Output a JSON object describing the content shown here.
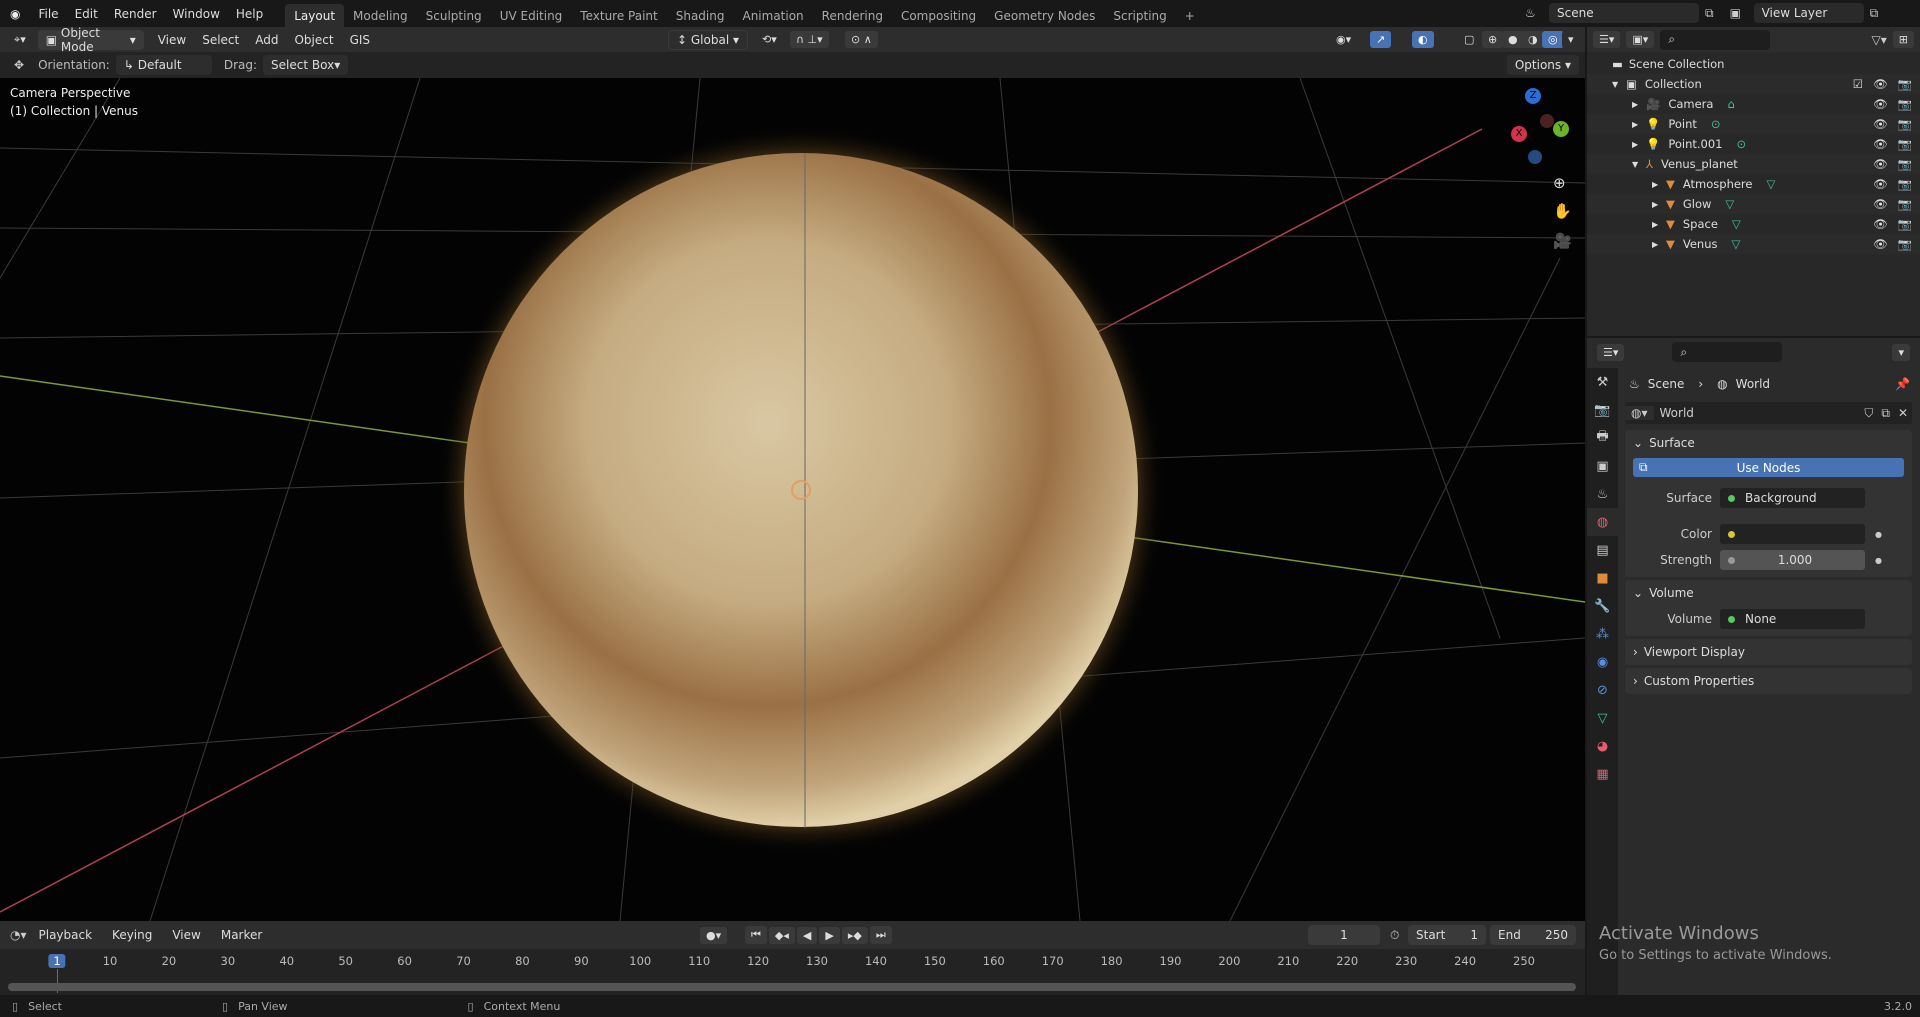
{
  "topbar": {
    "menus": [
      "File",
      "Edit",
      "Render",
      "Window",
      "Help"
    ],
    "workspaces": [
      "Layout",
      "Modeling",
      "Sculpting",
      "UV Editing",
      "Texture Paint",
      "Shading",
      "Animation",
      "Rendering",
      "Compositing",
      "Geometry Nodes",
      "Scripting"
    ],
    "active_workspace": "Layout",
    "add": "+",
    "scene": "Scene",
    "view_layer": "View Layer"
  },
  "viewport_header": {
    "mode": "Object Mode",
    "menus": [
      "View",
      "Select",
      "Add",
      "Object",
      "GIS"
    ],
    "transform": "Global"
  },
  "tool_settings": {
    "orientation_label": "Orientation:",
    "orientation": "Default",
    "drag_label": "Drag:",
    "drag": "Select Box",
    "options": "Options"
  },
  "viewport": {
    "camera": "Camera Perspective",
    "collection": "(1) Collection | Venus",
    "gizmo": {
      "x": "X",
      "y": "Y",
      "z": "Z"
    }
  },
  "outliner": {
    "root": "Scene Collection",
    "items": [
      {
        "name": "Collection",
        "depth": 0,
        "icon": "collection"
      },
      {
        "name": "Camera",
        "depth": 1,
        "icon": "camera"
      },
      {
        "name": "Point",
        "depth": 1,
        "icon": "light"
      },
      {
        "name": "Point.001",
        "depth": 1,
        "icon": "light"
      },
      {
        "name": "Venus_planet",
        "depth": 1,
        "icon": "empty"
      },
      {
        "name": "Atmosphere",
        "depth": 2,
        "icon": "mesh"
      },
      {
        "name": "Glow",
        "depth": 2,
        "icon": "mesh"
      },
      {
        "name": "Space",
        "depth": 2,
        "icon": "mesh"
      },
      {
        "name": "Venus",
        "depth": 2,
        "icon": "mesh"
      }
    ]
  },
  "properties": {
    "breadcrumb": [
      "Scene",
      "World"
    ],
    "datablock": "World",
    "surface": {
      "title": "Surface",
      "use_nodes": "Use Nodes",
      "surface_label": "Surface",
      "surface_value": "Background",
      "color_label": "Color",
      "strength_label": "Strength",
      "strength": "1.000"
    },
    "volume": {
      "title": "Volume",
      "label": "Volume",
      "value": "None"
    },
    "viewport_display": "Viewport Display",
    "custom_properties": "Custom Properties"
  },
  "timeline": {
    "menus": [
      "Playback",
      "Keying",
      "View",
      "Marker"
    ],
    "current_frame": "1",
    "start_label": "Start",
    "start": "1",
    "end_label": "End",
    "end": "250",
    "ticks": [
      "1",
      "10",
      "20",
      "30",
      "40",
      "50",
      "60",
      "70",
      "80",
      "90",
      "100",
      "110",
      "120",
      "130",
      "140",
      "150",
      "160",
      "170",
      "180",
      "190",
      "200",
      "210",
      "220",
      "230",
      "240",
      "250"
    ]
  },
  "watermark": {
    "title": "Activate Windows",
    "subtitle": "Go to Settings to activate Windows."
  },
  "status": {
    "select": "Select",
    "pan": "Pan View",
    "context": "Context Menu",
    "version": "3.2.0"
  },
  "colors": {
    "accent": "#4772b3",
    "orange": "#e08a3c",
    "teal": "#3fc1a0"
  }
}
